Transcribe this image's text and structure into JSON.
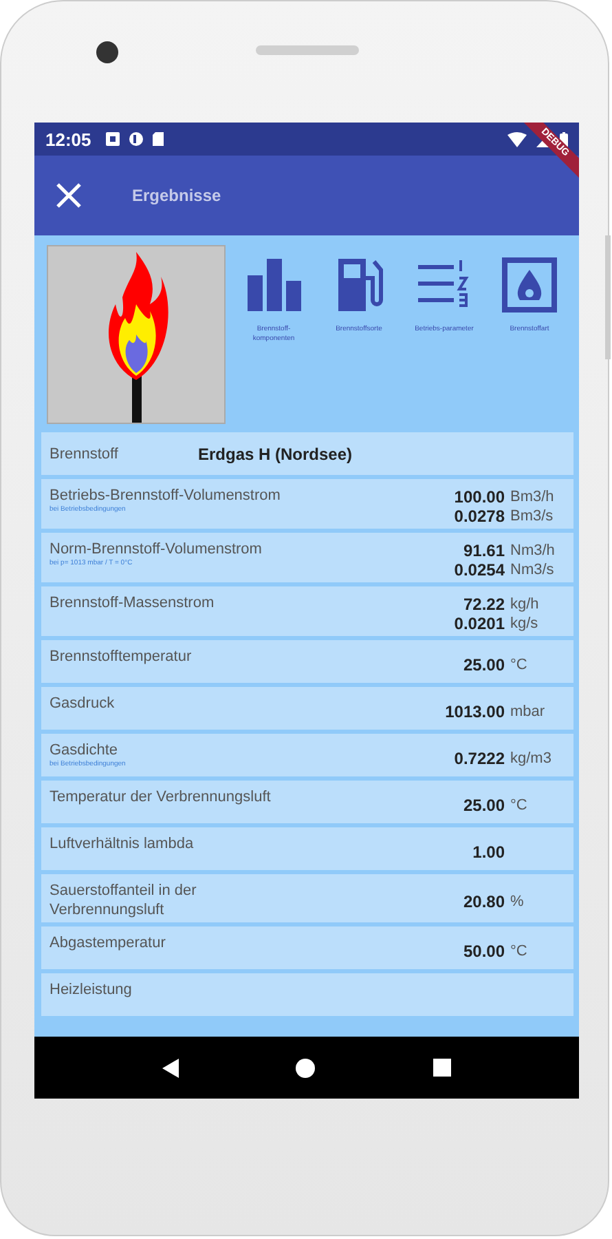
{
  "status_bar": {
    "time": "12:05",
    "debug_banner": "DEBUG"
  },
  "app_bar": {
    "title": "Ergebnisse"
  },
  "tiles": [
    {
      "kind": "bars",
      "label": "Brennstoff-komponenten"
    },
    {
      "kind": "pump",
      "label": "Brennstoffsorte"
    },
    {
      "kind": "list",
      "label": "Betriebs-parameter"
    },
    {
      "kind": "fireplace",
      "label": "Brennstoffart"
    }
  ],
  "fuel": {
    "label": "Brennstoff",
    "value": "Erdgas H (Nordsee)"
  },
  "results": [
    {
      "label": "Betriebs-Brennstoff-Volumenstrom",
      "note": "bei Betriebsbedingungen",
      "values": [
        {
          "value": "100.00",
          "unit": "Bm3/h"
        },
        {
          "value": "0.0278",
          "unit": "Bm3/s"
        }
      ]
    },
    {
      "label": "Norm-Brennstoff-Volumenstrom",
      "note": "bei p= 1013 mbar / T = 0°C",
      "values": [
        {
          "value": "91.61",
          "unit": "Nm3/h"
        },
        {
          "value": "0.0254",
          "unit": "Nm3/s"
        }
      ]
    },
    {
      "label": "Brennstoff-Massenstrom",
      "values": [
        {
          "value": "72.22",
          "unit": "kg/h"
        },
        {
          "value": "0.0201",
          "unit": "kg/s"
        }
      ]
    },
    {
      "label": "Brennstofftemperatur",
      "values": [
        {
          "value": "25.00",
          "unit": "°C"
        }
      ]
    },
    {
      "label": "Gasdruck",
      "values": [
        {
          "value": "1013.00",
          "unit": "mbar"
        }
      ]
    },
    {
      "label": "Gasdichte",
      "note": "bei Betriebsbedingungen",
      "values": [
        {
          "value": "0.7222",
          "unit": "kg/m3"
        }
      ]
    },
    {
      "label": "Temperatur der Verbrennungsluft",
      "values": [
        {
          "value": "25.00",
          "unit": "°C"
        }
      ]
    },
    {
      "label": "Luftverhältnis lambda",
      "values": [
        {
          "value": "1.00"
        }
      ]
    },
    {
      "label": "Sauerstoffanteil in der Verbrennungsluft",
      "values": [
        {
          "value": "20.80",
          "unit": "%"
        }
      ]
    },
    {
      "label": "Abgastemperatur",
      "values": [
        {
          "value": "50.00",
          "unit": "°C"
        }
      ]
    },
    {
      "label": "Heizleistung"
    }
  ]
}
